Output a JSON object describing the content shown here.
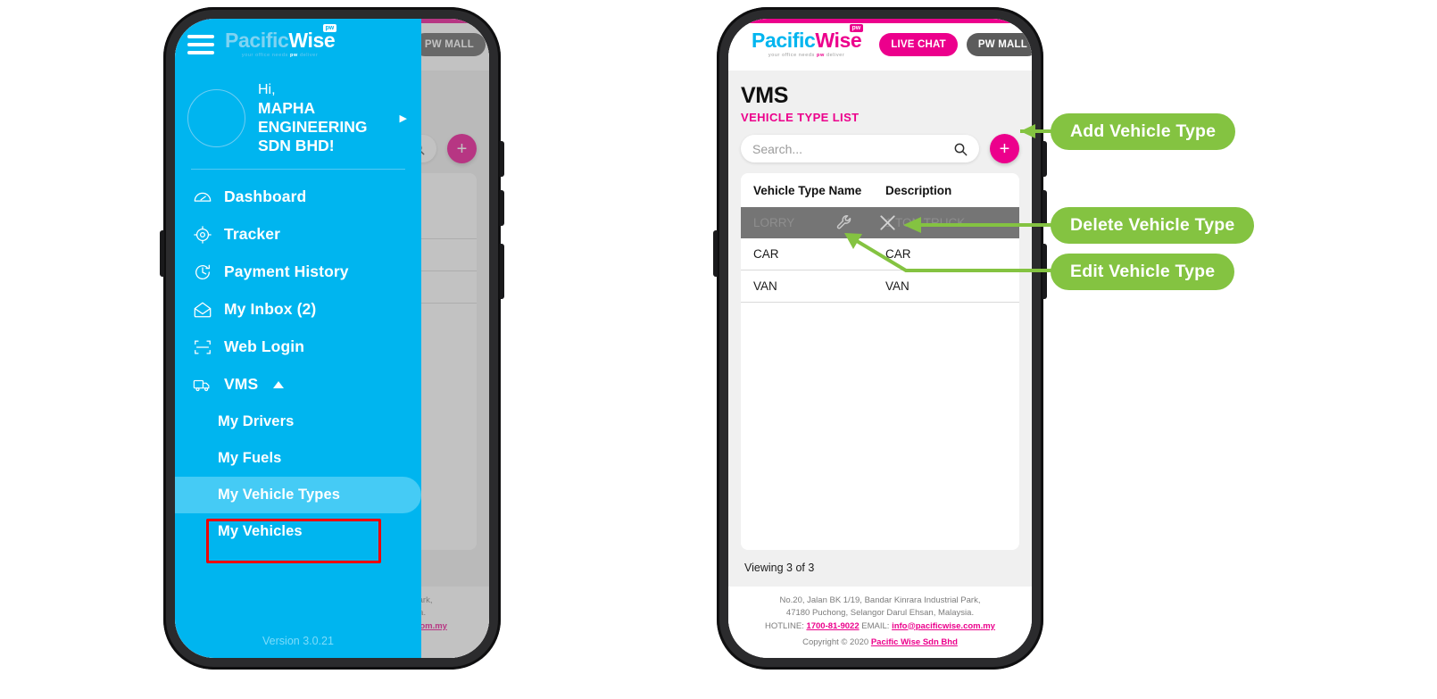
{
  "brand": {
    "logo_main_part1": "Pacific",
    "logo_main_part2": "Wise",
    "logo_badge": "pw",
    "logo_tagline_pre": "your office needs ",
    "logo_tagline_badge": "pw",
    "logo_tagline_post": " deliver",
    "color_cyan": "#00b5ef",
    "color_magenta": "#ec008c",
    "color_callout_green": "#84c341",
    "color_highlight_red": "#ee0000",
    "color_row_selected": "#757575"
  },
  "topbar": {
    "menu_icon": "hamburger-icon",
    "live_chat_label": "LIVE CHAT",
    "pw_mall_label": "PW MALL"
  },
  "page": {
    "title": "VMS",
    "subtitle": "VEHICLE TYPE LIST",
    "search_placeholder": "Search...",
    "search_value": "",
    "search_icon": "search-icon",
    "add_button_label": "+",
    "columns": [
      "Vehicle Type Name",
      "Description"
    ],
    "rows": [
      {
        "name": "LORRY",
        "description": "1 TON TRUCK",
        "selected": true
      },
      {
        "name": "CAR",
        "description": "CAR",
        "selected": false
      },
      {
        "name": "VAN",
        "description": "VAN",
        "selected": false
      }
    ],
    "row_actions": {
      "edit_icon": "wrench-icon",
      "delete_icon": "close-x-icon"
    },
    "viewing_text": "Viewing 3 of 3"
  },
  "footer": {
    "address_line1": "No.20, Jalan BK 1/19, Bandar Kinrara Industrial Park,",
    "address_line2": "47180 Puchong, Selangor Darul Ehsan, Malaysia.",
    "hotline_label": "HOTLINE: ",
    "hotline_value": "1700-81-9022",
    "email_label": " EMAIL: ",
    "email_value": "info@pacificwise.com.my",
    "copyright_pre": "Copyright © 2020 ",
    "copyright_link": "Pacific Wise Sdn Bhd"
  },
  "drawer": {
    "greeting": "Hi,",
    "company_name": "MAPHA ENGINEERING SDN BHD!",
    "profile_caret_icon": "caret-right-icon",
    "avatar_icon": "avatar",
    "items": [
      {
        "label": "Dashboard",
        "icon": "dashboard-gauge-icon"
      },
      {
        "label": "Tracker",
        "icon": "tracker-target-icon"
      },
      {
        "label": "Payment History",
        "icon": "clock-history-icon"
      },
      {
        "label": "My Inbox (2)",
        "icon": "envelope-icon"
      },
      {
        "label": "Web Login",
        "icon": "web-login-frame-icon"
      },
      {
        "label": "VMS",
        "icon": "truck-icon",
        "expand_icon": "caret-up-icon",
        "expanded": true
      }
    ],
    "subitems": [
      {
        "label": "My Drivers",
        "selected": false
      },
      {
        "label": "My Fuels",
        "selected": false
      },
      {
        "label": "My Vehicle Types",
        "selected": true
      },
      {
        "label": "My Vehicles",
        "selected": false
      }
    ],
    "version": "Version 3.0.21"
  },
  "callouts": [
    {
      "label": "Add Vehicle Type"
    },
    {
      "label": "Delete Vehicle Type"
    },
    {
      "label": "Edit Vehicle Type"
    }
  ]
}
